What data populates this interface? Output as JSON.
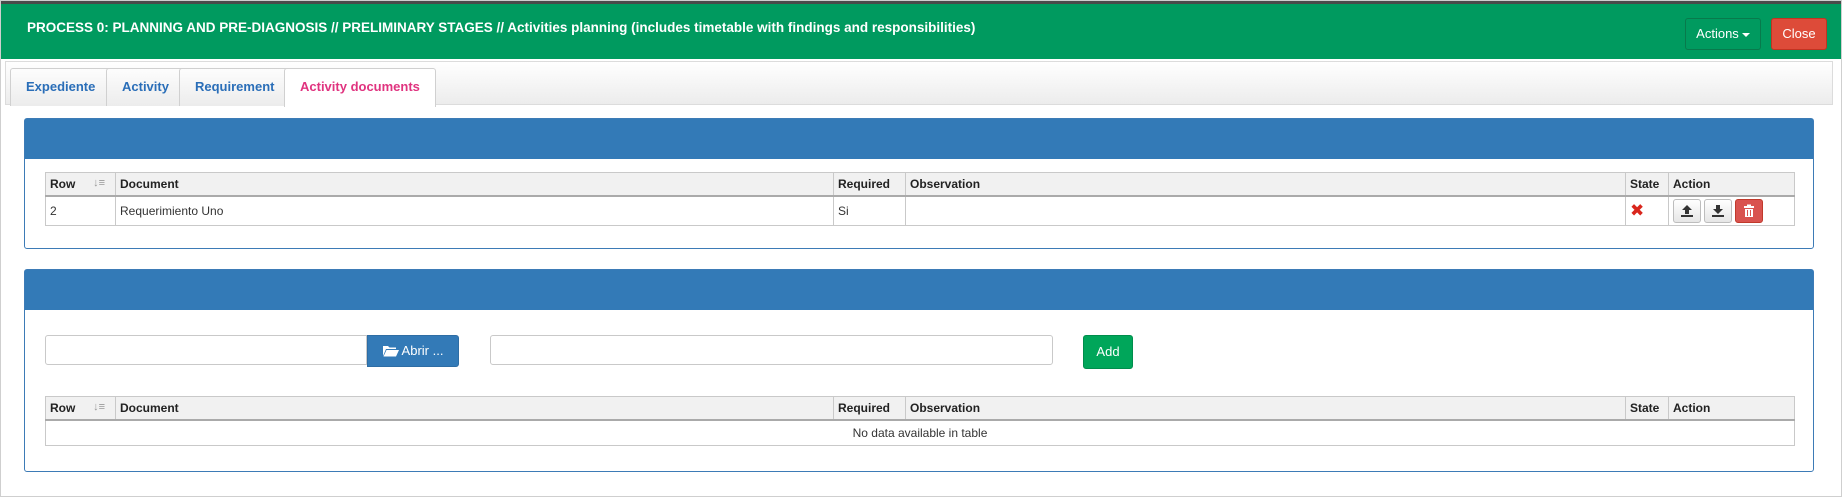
{
  "header": {
    "title": "PROCESS 0: PLANNING AND PRE-DIAGNOSIS // PRELIMINARY STAGES // Activities planning (includes timetable with findings and responsibilities)",
    "actions_label": "Actions",
    "close_label": "Close",
    "bg_color": "#009a5f"
  },
  "tabs": [
    {
      "label": "Expediente",
      "active": false
    },
    {
      "label": "Activity",
      "active": false
    },
    {
      "label": "Requirement",
      "active": false
    },
    {
      "label": "Activity documents",
      "active": true
    }
  ],
  "documents_table": {
    "columns": [
      "Row",
      "Document",
      "Required",
      "Observation",
      "State",
      "Action"
    ],
    "rows": [
      {
        "row": "2",
        "document": "Requerimiento Uno",
        "required": "Si",
        "observation": "",
        "state_icon": "x-mark-icon"
      }
    ],
    "action_icons": [
      "upload-icon",
      "download-icon",
      "trash-icon"
    ]
  },
  "upload_form": {
    "file_placeholder": "",
    "open_label": "Abrir ...",
    "observation_placeholder": "",
    "add_label": "Add"
  },
  "uploaded_table": {
    "columns": [
      "Row",
      "Document",
      "Required",
      "Observation",
      "State",
      "Action"
    ],
    "empty_message": "No data available in table"
  },
  "colors": {
    "panel_heading": "#337ab7",
    "active_tab_text": "#e0337f",
    "tab_text": "#2a6eb8",
    "close_button": "#dd4b39",
    "add_button": "#00a65a"
  }
}
